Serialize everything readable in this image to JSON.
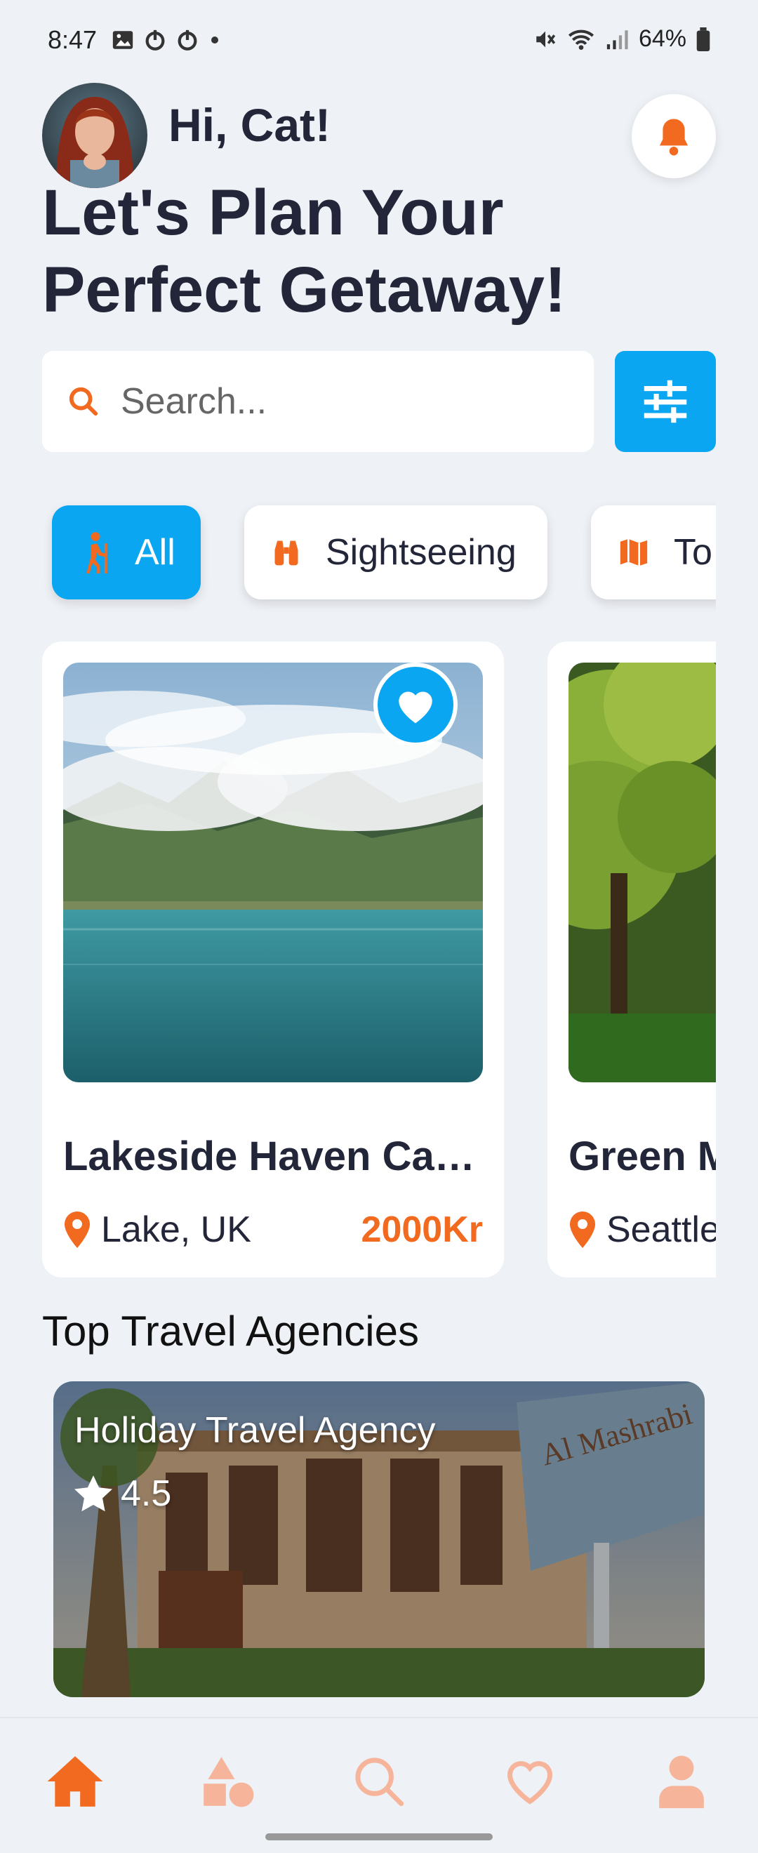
{
  "status_bar": {
    "time": "8:47",
    "battery": "64%",
    "icons": [
      "gallery-icon",
      "power-icon",
      "power-icon",
      "dot-icon",
      "mute-icon",
      "wifi-icon",
      "signal-icon",
      "battery-icon"
    ]
  },
  "header": {
    "greeting": "Hi, Cat!",
    "headline": "Let's Plan Your Perfect Getaway!"
  },
  "search": {
    "placeholder": "Search..."
  },
  "categories": [
    {
      "label": "All",
      "icon": "hiking-icon",
      "active": true
    },
    {
      "label": "Sightseeing",
      "icon": "binoculars-icon",
      "active": false
    },
    {
      "label": "To",
      "icon": "map-icon",
      "active": false
    }
  ],
  "destinations": [
    {
      "name": "Lakeside Haven Ca…",
      "location": "Lake, UK",
      "price": "2000Kr",
      "favorite": true
    },
    {
      "name": "Green M",
      "location": "Seattle",
      "price": ""
    }
  ],
  "agencies_section": {
    "title": "Top Travel Agencies",
    "items": [
      {
        "name": "Holiday Travel Agency",
        "rating": "4.5",
        "sign_text": "Al Mashrabi"
      }
    ]
  },
  "nav": {
    "items": [
      "home-icon",
      "shapes-icon",
      "search-icon",
      "heart-icon",
      "user-icon"
    ]
  },
  "colors": {
    "accent_blue": "#0aa6f2",
    "accent_orange": "#f26a1f",
    "background": "#eef1f6",
    "text_dark": "#222638"
  }
}
